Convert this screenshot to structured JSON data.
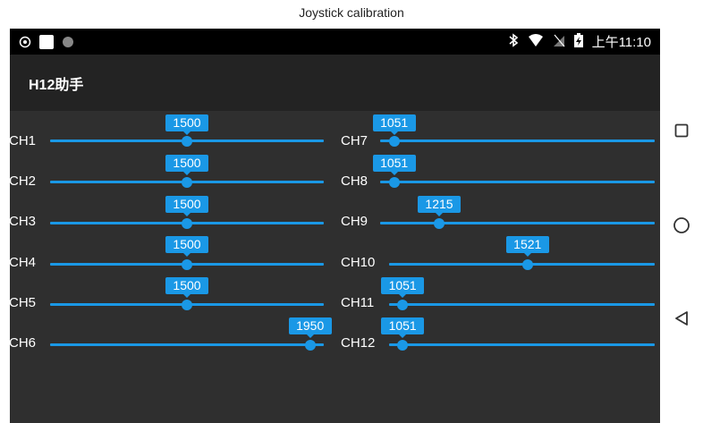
{
  "caption": "Joystick calibration",
  "statusbar": {
    "time": "上午11:10",
    "icons_left": [
      "notification-icon",
      "app-square-icon",
      "dot-icon"
    ],
    "icons_right": [
      "bluetooth-icon",
      "wifi-icon",
      "no-sim-icon",
      "battery-charging-icon"
    ]
  },
  "app": {
    "title": "H12助手"
  },
  "slider_range": [
    1000,
    2000
  ],
  "left_channels": [
    {
      "label": "CH1",
      "value": "1500"
    },
    {
      "label": "CH2",
      "value": "1500"
    },
    {
      "label": "CH3",
      "value": "1500"
    },
    {
      "label": "CH4",
      "value": "1500"
    },
    {
      "label": "CH5",
      "value": "1500"
    },
    {
      "label": "CH6",
      "value": "1950"
    }
  ],
  "right_channels": [
    {
      "label": "CH7",
      "value": "1051"
    },
    {
      "label": "CH8",
      "value": "1051"
    },
    {
      "label": "CH9",
      "value": "1215"
    },
    {
      "label": "CH10",
      "value": "1521"
    },
    {
      "label": "CH11",
      "value": "1051"
    },
    {
      "label": "CH12",
      "value": "1051"
    }
  ],
  "navbar": {
    "buttons": [
      "square-recents-icon",
      "circle-home-icon",
      "triangle-back-icon"
    ]
  },
  "colors": {
    "accent": "#1a98e6",
    "background": "#2f2f2f",
    "appbar": "#232323",
    "statusbar": "#000000"
  }
}
